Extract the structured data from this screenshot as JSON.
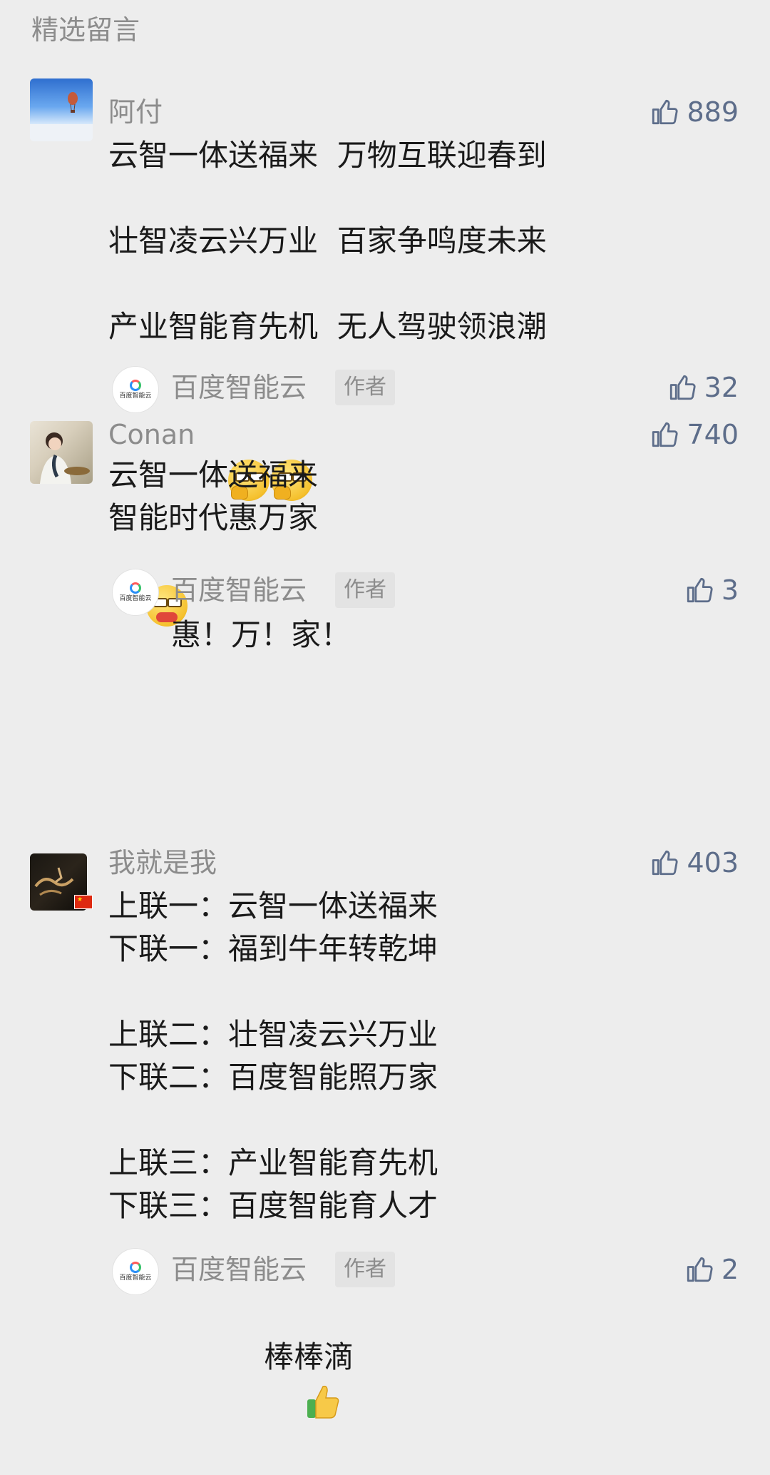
{
  "section_title": "精选留言",
  "author_tag": "作者",
  "comments": [
    {
      "name": "阿付",
      "likes": "889",
      "avatar_icon": "hot-air-balloon-sky-avatar",
      "text": "云智一体送福来  万物互联迎春到\n\n壮智凌云兴万业  百家争鸣度未来\n\n产业智能育先机  无人驾驶领浪潮",
      "reply": {
        "name": "百度智能云",
        "likes": "32",
        "avatar_label": "百度智能云",
        "text": "",
        "emojis": [
          "glasses-smirk-emoji",
          "glasses-smirk-emoji"
        ]
      }
    },
    {
      "name": "Conan",
      "likes": "740",
      "avatar_icon": "person-photo-avatar",
      "text": "云智一体送福来\n智能时代惠万家",
      "emojis": [
        "glasses-mask-emoji"
      ],
      "reply": {
        "name": "百度智能云",
        "likes": "3",
        "avatar_label": "百度智能云",
        "text": "惠！万！家！"
      }
    },
    {
      "name": "我就是我",
      "likes": "403",
      "avatar_icon": "calligraphy-dark-avatar",
      "text": "上联一：云智一体送福来\n下联一：福到牛年转乾坤\n\n上联二：壮智凌云兴万业\n下联二：百度智能照万家\n\n上联三：产业智能育先机\n下联三：百度智能育人才",
      "reply": {
        "name": "百度智能云",
        "likes": "2",
        "avatar_label": "百度智能云",
        "text": "棒棒滴",
        "emojis": [
          "thumbs-up-emoji"
        ]
      }
    }
  ],
  "colors": {
    "background": "#ededed",
    "muted_text": "#8c8c8c",
    "like_blue_gray": "#5d6d8a",
    "body_text": "#1a1a1a"
  }
}
